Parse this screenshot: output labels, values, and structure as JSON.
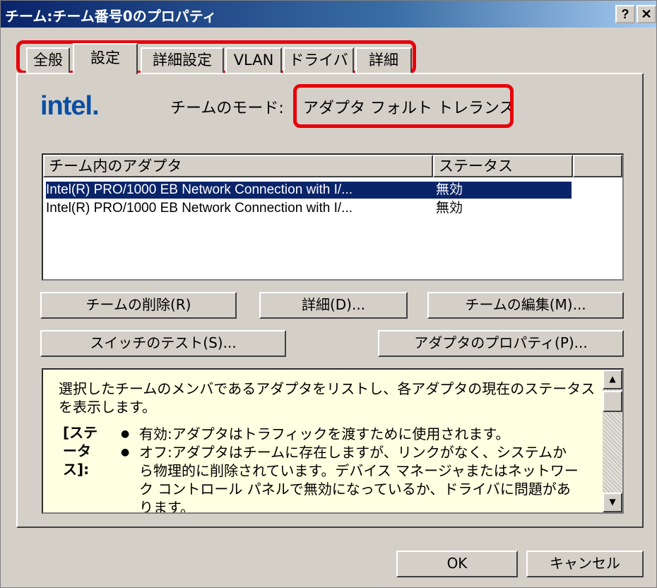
{
  "window": {
    "title": "チーム:チーム番号0のプロパティ",
    "help_label": "?",
    "close_label": "✕"
  },
  "tabs": [
    {
      "label": "全般"
    },
    {
      "label": "設定",
      "active": true
    },
    {
      "label": "詳細設定"
    },
    {
      "label": "VLAN"
    },
    {
      "label": "ドライバ"
    },
    {
      "label": "詳細"
    }
  ],
  "logo": {
    "text": "intel.",
    "icon": "intel-logo"
  },
  "team_mode": {
    "label": "チームのモード:",
    "value": "アダプタ フォルト トレランス"
  },
  "adapters_table": {
    "columns": [
      "チーム内のアダプタ",
      "ステータス"
    ],
    "rows": [
      {
        "name": "Intel(R) PRO/1000 EB Network Connection with I/...",
        "status": "無効",
        "selected": true
      },
      {
        "name": "Intel(R) PRO/1000 EB Network Connection with I/...",
        "status": "無効",
        "selected": false
      }
    ]
  },
  "buttons": {
    "remove_team": "チームの削除(R)",
    "details": "詳細(D)...",
    "edit_team": "チームの編集(M)...",
    "test_switch": "スイッチのテスト(S)...",
    "adapter_properties": "アダプタのプロパティ(P)...",
    "ok": "OK",
    "cancel": "キャンセル"
  },
  "help": {
    "intro": "選択したチームのメンバであるアダプタをリストし、各アダプタの現在のステータスを表示します。",
    "status_heading": "[ステータス]:",
    "bullets": [
      "有効:アダプタはトラフィックを渡すために使用されます。",
      "オフ:アダプタはチームに存在しますが、リンクがなく、システムから物理的に削除されています。デバイス マネージャまたはネットワーク コントロール パネルで無効になっているか、ドライバに問題があります。"
    ]
  },
  "colors": {
    "highlight": "#e8000b",
    "selection": "#0a246a",
    "help_background": "#ffffe1",
    "intel_blue": "#0a4fa3"
  }
}
